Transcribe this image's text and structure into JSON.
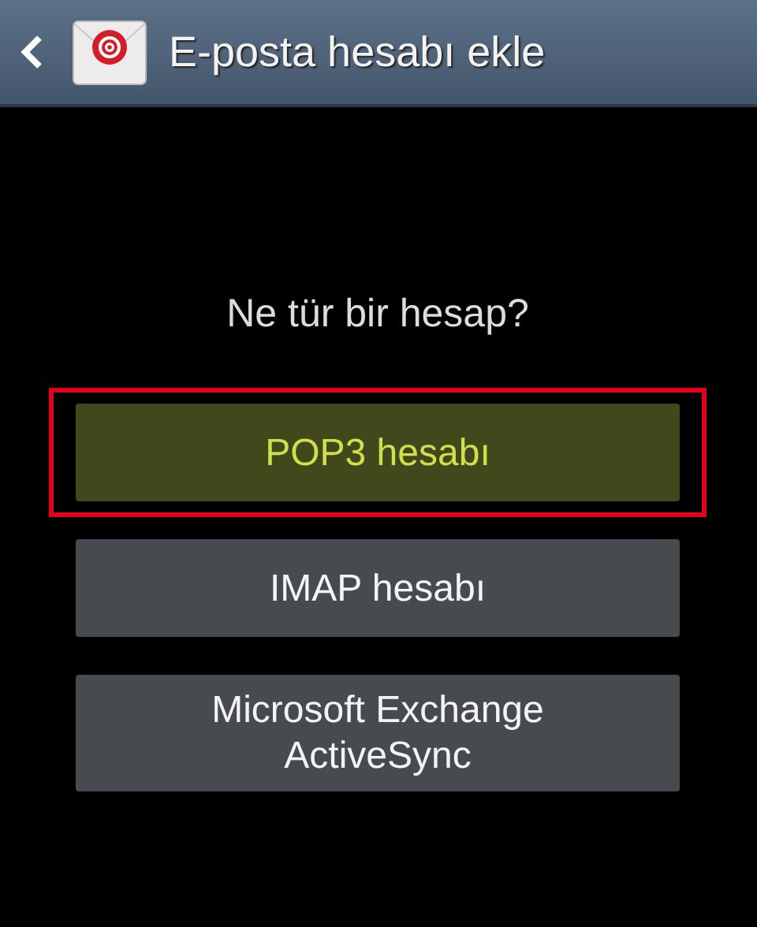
{
  "header": {
    "title": "E-posta hesabı ekle"
  },
  "question": "Ne tür bir hesap?",
  "options": [
    {
      "label": "POP3 hesabı",
      "selected": true,
      "highlighted": true
    },
    {
      "label": "IMAP hesabı",
      "selected": false,
      "highlighted": false
    },
    {
      "label": "Microsoft Exchange ActiveSync",
      "selected": false,
      "highlighted": false
    }
  ]
}
